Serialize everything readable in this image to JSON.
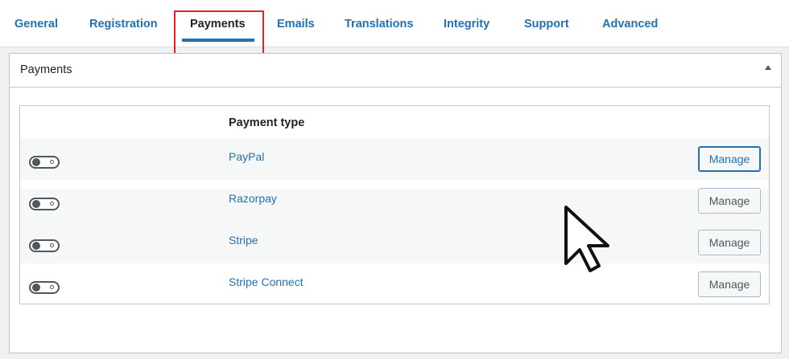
{
  "tabs": [
    {
      "label": "General"
    },
    {
      "label": "Registration"
    },
    {
      "label": "Payments",
      "active": true
    },
    {
      "label": "Emails"
    },
    {
      "label": "Translations"
    },
    {
      "label": "Integrity"
    },
    {
      "label": "Support"
    },
    {
      "label": "Advanced"
    }
  ],
  "panel": {
    "title": "Payments",
    "table": {
      "header": "Payment type",
      "rows": [
        {
          "name": "PayPal",
          "enabled": false,
          "button": "Manage"
        },
        {
          "name": "Razorpay",
          "enabled": false,
          "button": "Manage"
        },
        {
          "name": "Stripe",
          "enabled": false,
          "button": "Manage"
        },
        {
          "name": "Stripe Connect",
          "enabled": false,
          "button": "Manage"
        }
      ]
    }
  },
  "colors": {
    "accent": "#2271b1",
    "highlight": "#e0242a"
  },
  "icons": {
    "panel_toggle": "triangle-up-icon",
    "cursor": "mouse-pointer-icon"
  }
}
